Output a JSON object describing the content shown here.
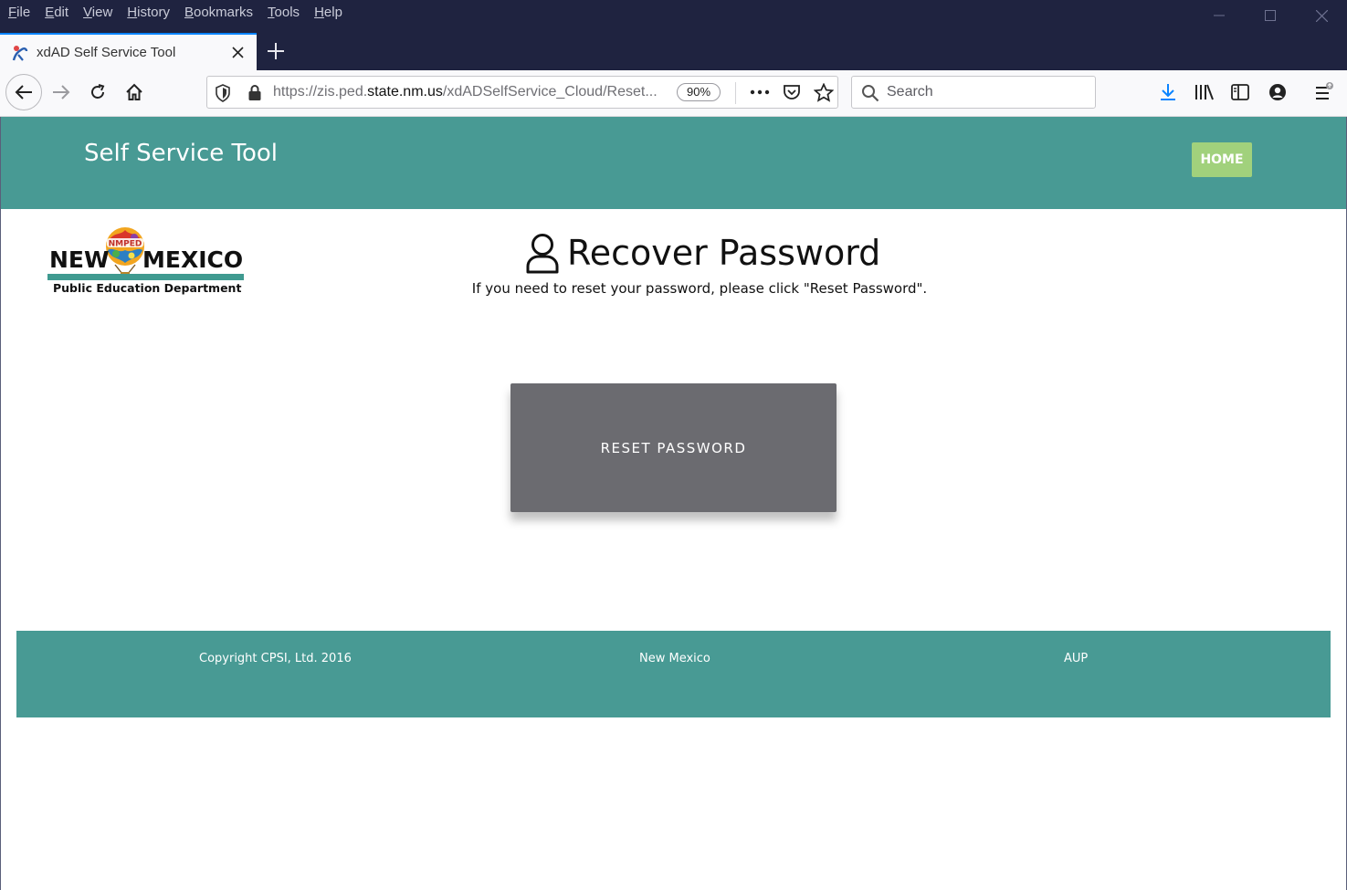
{
  "browser": {
    "menu": [
      {
        "label": "File",
        "key": "F",
        "rest": "ile"
      },
      {
        "label": "Edit",
        "key": "E",
        "rest": "dit"
      },
      {
        "label": "View",
        "key": "V",
        "rest": "iew"
      },
      {
        "label": "History",
        "key": "H",
        "rest": "istory"
      },
      {
        "label": "Bookmarks",
        "key": "B",
        "rest": "ookmarks"
      },
      {
        "label": "Tools",
        "key": "T",
        "rest": "ools"
      },
      {
        "label": "Help",
        "key": "H",
        "rest": "elp"
      }
    ],
    "tab_title": "xdAD Self Service Tool",
    "url_prefix": "https://zis.ped.",
    "url_host": "state.nm.us",
    "url_path": "/xdADSelfService_Cloud/Reset...",
    "zoom": "90%",
    "search_placeholder": "Search"
  },
  "site": {
    "title": "Self Service Tool",
    "home_label": "HOME",
    "logo": {
      "word1": "NEW",
      "word2": "MEXICO",
      "badge": "NMPED",
      "subtitle": "Public Education Department"
    },
    "heading": "Recover Password",
    "instructions": "If you need to reset your password, please click \"Reset Password\".",
    "reset_button": "RESET PASSWORD",
    "footer": {
      "copyright": "Copyright CPSI, Ltd. 2016",
      "state": "New Mexico",
      "aup": "AUP"
    }
  },
  "colors": {
    "titlebar": "#1f2340",
    "header_teal": "#489a94",
    "home_green": "#a1d17c",
    "reset_gray": "#6b6b70"
  }
}
